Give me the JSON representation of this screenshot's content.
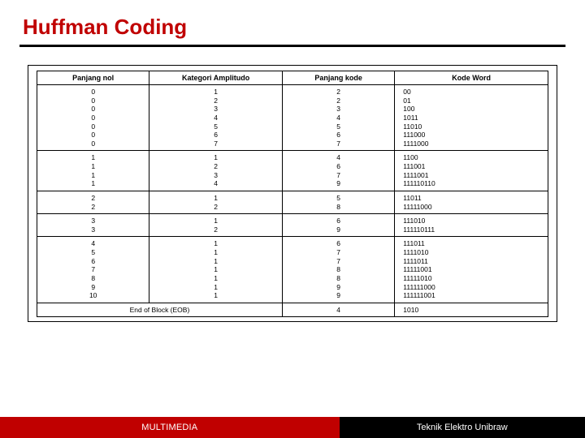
{
  "title": "Huffman Coding",
  "table": {
    "headers": [
      "Panjang nol",
      "Kategori Amplitudo",
      "Panjang kode",
      "Kode Word"
    ],
    "groups": [
      {
        "panjang_nol": [
          "0",
          "0",
          "0",
          "0",
          "0",
          "0",
          "0"
        ],
        "kategori": [
          "1",
          "2",
          "3",
          "4",
          "5",
          "6",
          "7"
        ],
        "panjang_kode": [
          "2",
          "2",
          "3",
          "4",
          "5",
          "6",
          "7"
        ],
        "kode_word": [
          "00",
          "01",
          "100",
          "1011",
          "11010",
          "111000",
          "1111000"
        ]
      },
      {
        "panjang_nol": [
          "1",
          "1",
          "1",
          "1"
        ],
        "kategori": [
          "1",
          "2",
          "3",
          "4"
        ],
        "panjang_kode": [
          "4",
          "6",
          "7",
          "9"
        ],
        "kode_word": [
          "1100",
          "111001",
          "1111001",
          "111110110"
        ]
      },
      {
        "panjang_nol": [
          "2",
          "2"
        ],
        "kategori": [
          "1",
          "2"
        ],
        "panjang_kode": [
          "5",
          "8"
        ],
        "kode_word": [
          "11011",
          "11111000"
        ]
      },
      {
        "panjang_nol": [
          "3",
          "3"
        ],
        "kategori": [
          "1",
          "2"
        ],
        "panjang_kode": [
          "6",
          "9"
        ],
        "kode_word": [
          "111010",
          "111110111"
        ]
      },
      {
        "panjang_nol": [
          "4",
          "5",
          "6",
          "7",
          "8",
          "9",
          "10"
        ],
        "kategori": [
          "1",
          "1",
          "1",
          "1",
          "1",
          "1",
          "1"
        ],
        "panjang_kode": [
          "6",
          "7",
          "7",
          "8",
          "8",
          "9",
          "9"
        ],
        "kode_word": [
          "111011",
          "1111010",
          "1111011",
          "11111001",
          "11111010",
          "111111000",
          "111111001"
        ]
      }
    ],
    "eob": {
      "label": "End of Block (EOB)",
      "panjang_kode": "4",
      "kode_word": "1010"
    }
  },
  "footer": {
    "left": "MULTIMEDIA",
    "right": "Teknik Elektro Unibraw"
  }
}
